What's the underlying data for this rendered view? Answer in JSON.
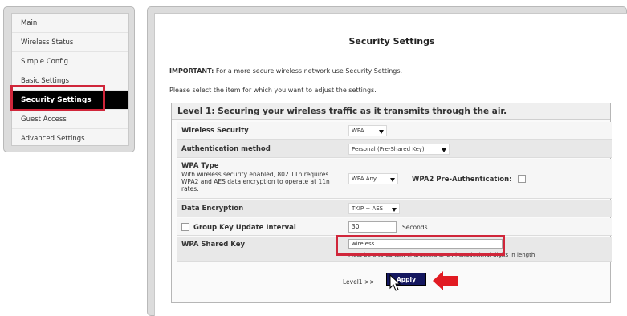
{
  "sidebar": {
    "items": [
      {
        "label": "Main"
      },
      {
        "label": "Wireless Status"
      },
      {
        "label": "Simple Config"
      },
      {
        "label": "Basic Settings"
      },
      {
        "label": "Security Settings"
      },
      {
        "label": "Guest Access"
      },
      {
        "label": "Advanced Settings"
      }
    ]
  },
  "main": {
    "title": "Security Settings",
    "important_label": "IMPORTANT:",
    "important_text": " For a more secure wireless network use Security Settings.",
    "select_text": "Please select the item for which you want to adjust the settings.",
    "level_title": "Level 1: Securing your wireless traffic as it transmits through the air."
  },
  "form": {
    "wireless_security": {
      "label": "Wireless Security",
      "value": "WPA"
    },
    "auth_method": {
      "label": "Authentication method",
      "value": "Personal (Pre-Shared Key)"
    },
    "wpa_type": {
      "label": "WPA Type",
      "description": "With wireless security enabled, 802.11n requires WPA2 and AES data encryption to operate at 11n rates.",
      "value": "WPA Any",
      "preauth_label": "WPA2 Pre-Authentication:"
    },
    "data_encryption": {
      "label": "Data Encryption",
      "value": "TKIP + AES"
    },
    "group_key": {
      "label": "Group Key Update Interval",
      "value": "30",
      "unit": "Seconds"
    },
    "shared_key": {
      "label": "WPA Shared Key",
      "value": "wireless",
      "hint": "Must be 8 to 63 text characters or 64 hexadecimal digits in length"
    }
  },
  "footer": {
    "level_link": "Level1 >>",
    "apply_label": "Apply"
  },
  "colors": {
    "highlight": "#d0263a",
    "apply_button": "#14175f",
    "active_nav": "#000000"
  }
}
